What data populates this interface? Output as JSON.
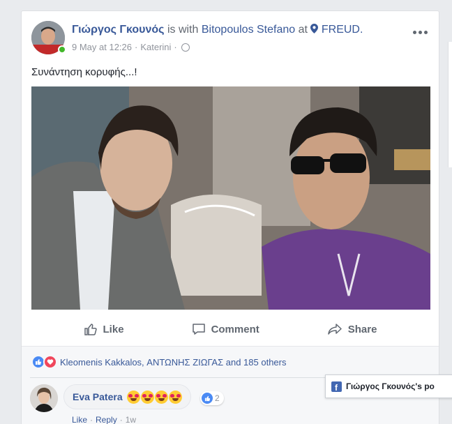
{
  "post": {
    "author": "Γιώργος Γκουνός",
    "with_text": "is with",
    "tagged": "Bitopoulos Stefano",
    "at_text": "at",
    "place": "FREUD.",
    "date": "9 May at 12:26",
    "sep": "·",
    "location": "Katerini",
    "text": "Συνάντηση κορυφής...!"
  },
  "actions": {
    "like": "Like",
    "comment": "Comment",
    "share": "Share"
  },
  "reactions": {
    "text": "Kleomenis Kakkalos, ΑΝΤΩΝΗΣ ΖΙΩΓΑΣ and 185 others",
    "colors": {
      "like": "#4a8af4",
      "love": "#f0465b"
    }
  },
  "comment": {
    "author": "Eva Patera",
    "emoji_count": 4,
    "emoji_name": "heart-eyes-emoji",
    "like_count": "2",
    "like_label": "Like",
    "reply_label": "Reply",
    "sep": "·",
    "time": "1w"
  },
  "chat_tab": {
    "label": "Γιώργος Γκουνός's po"
  },
  "colors": {
    "link": "#385898",
    "online": "#42b72a",
    "brand": "#4267b2"
  }
}
